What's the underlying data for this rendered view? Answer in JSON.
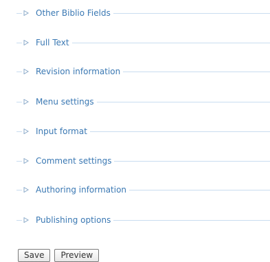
{
  "fieldsets": [
    {
      "label": "Other Biblio Fields",
      "icon": "triangle-right-icon"
    },
    {
      "label": "Full Text",
      "icon": "triangle-right-icon"
    },
    {
      "label": "Revision information",
      "icon": "triangle-right-icon"
    },
    {
      "label": "Menu settings",
      "icon": "triangle-right-icon"
    },
    {
      "label": "Input format",
      "icon": "triangle-right-icon"
    },
    {
      "label": "Comment settings",
      "icon": "triangle-right-icon"
    },
    {
      "label": "Authoring information",
      "icon": "triangle-right-icon"
    },
    {
      "label": "Publishing options",
      "icon": "triangle-right-icon"
    }
  ],
  "actions": {
    "save_label": "Save",
    "preview_label": "Preview"
  },
  "colors": {
    "link": "#3a78b3",
    "divider": "#c9ddf0"
  }
}
